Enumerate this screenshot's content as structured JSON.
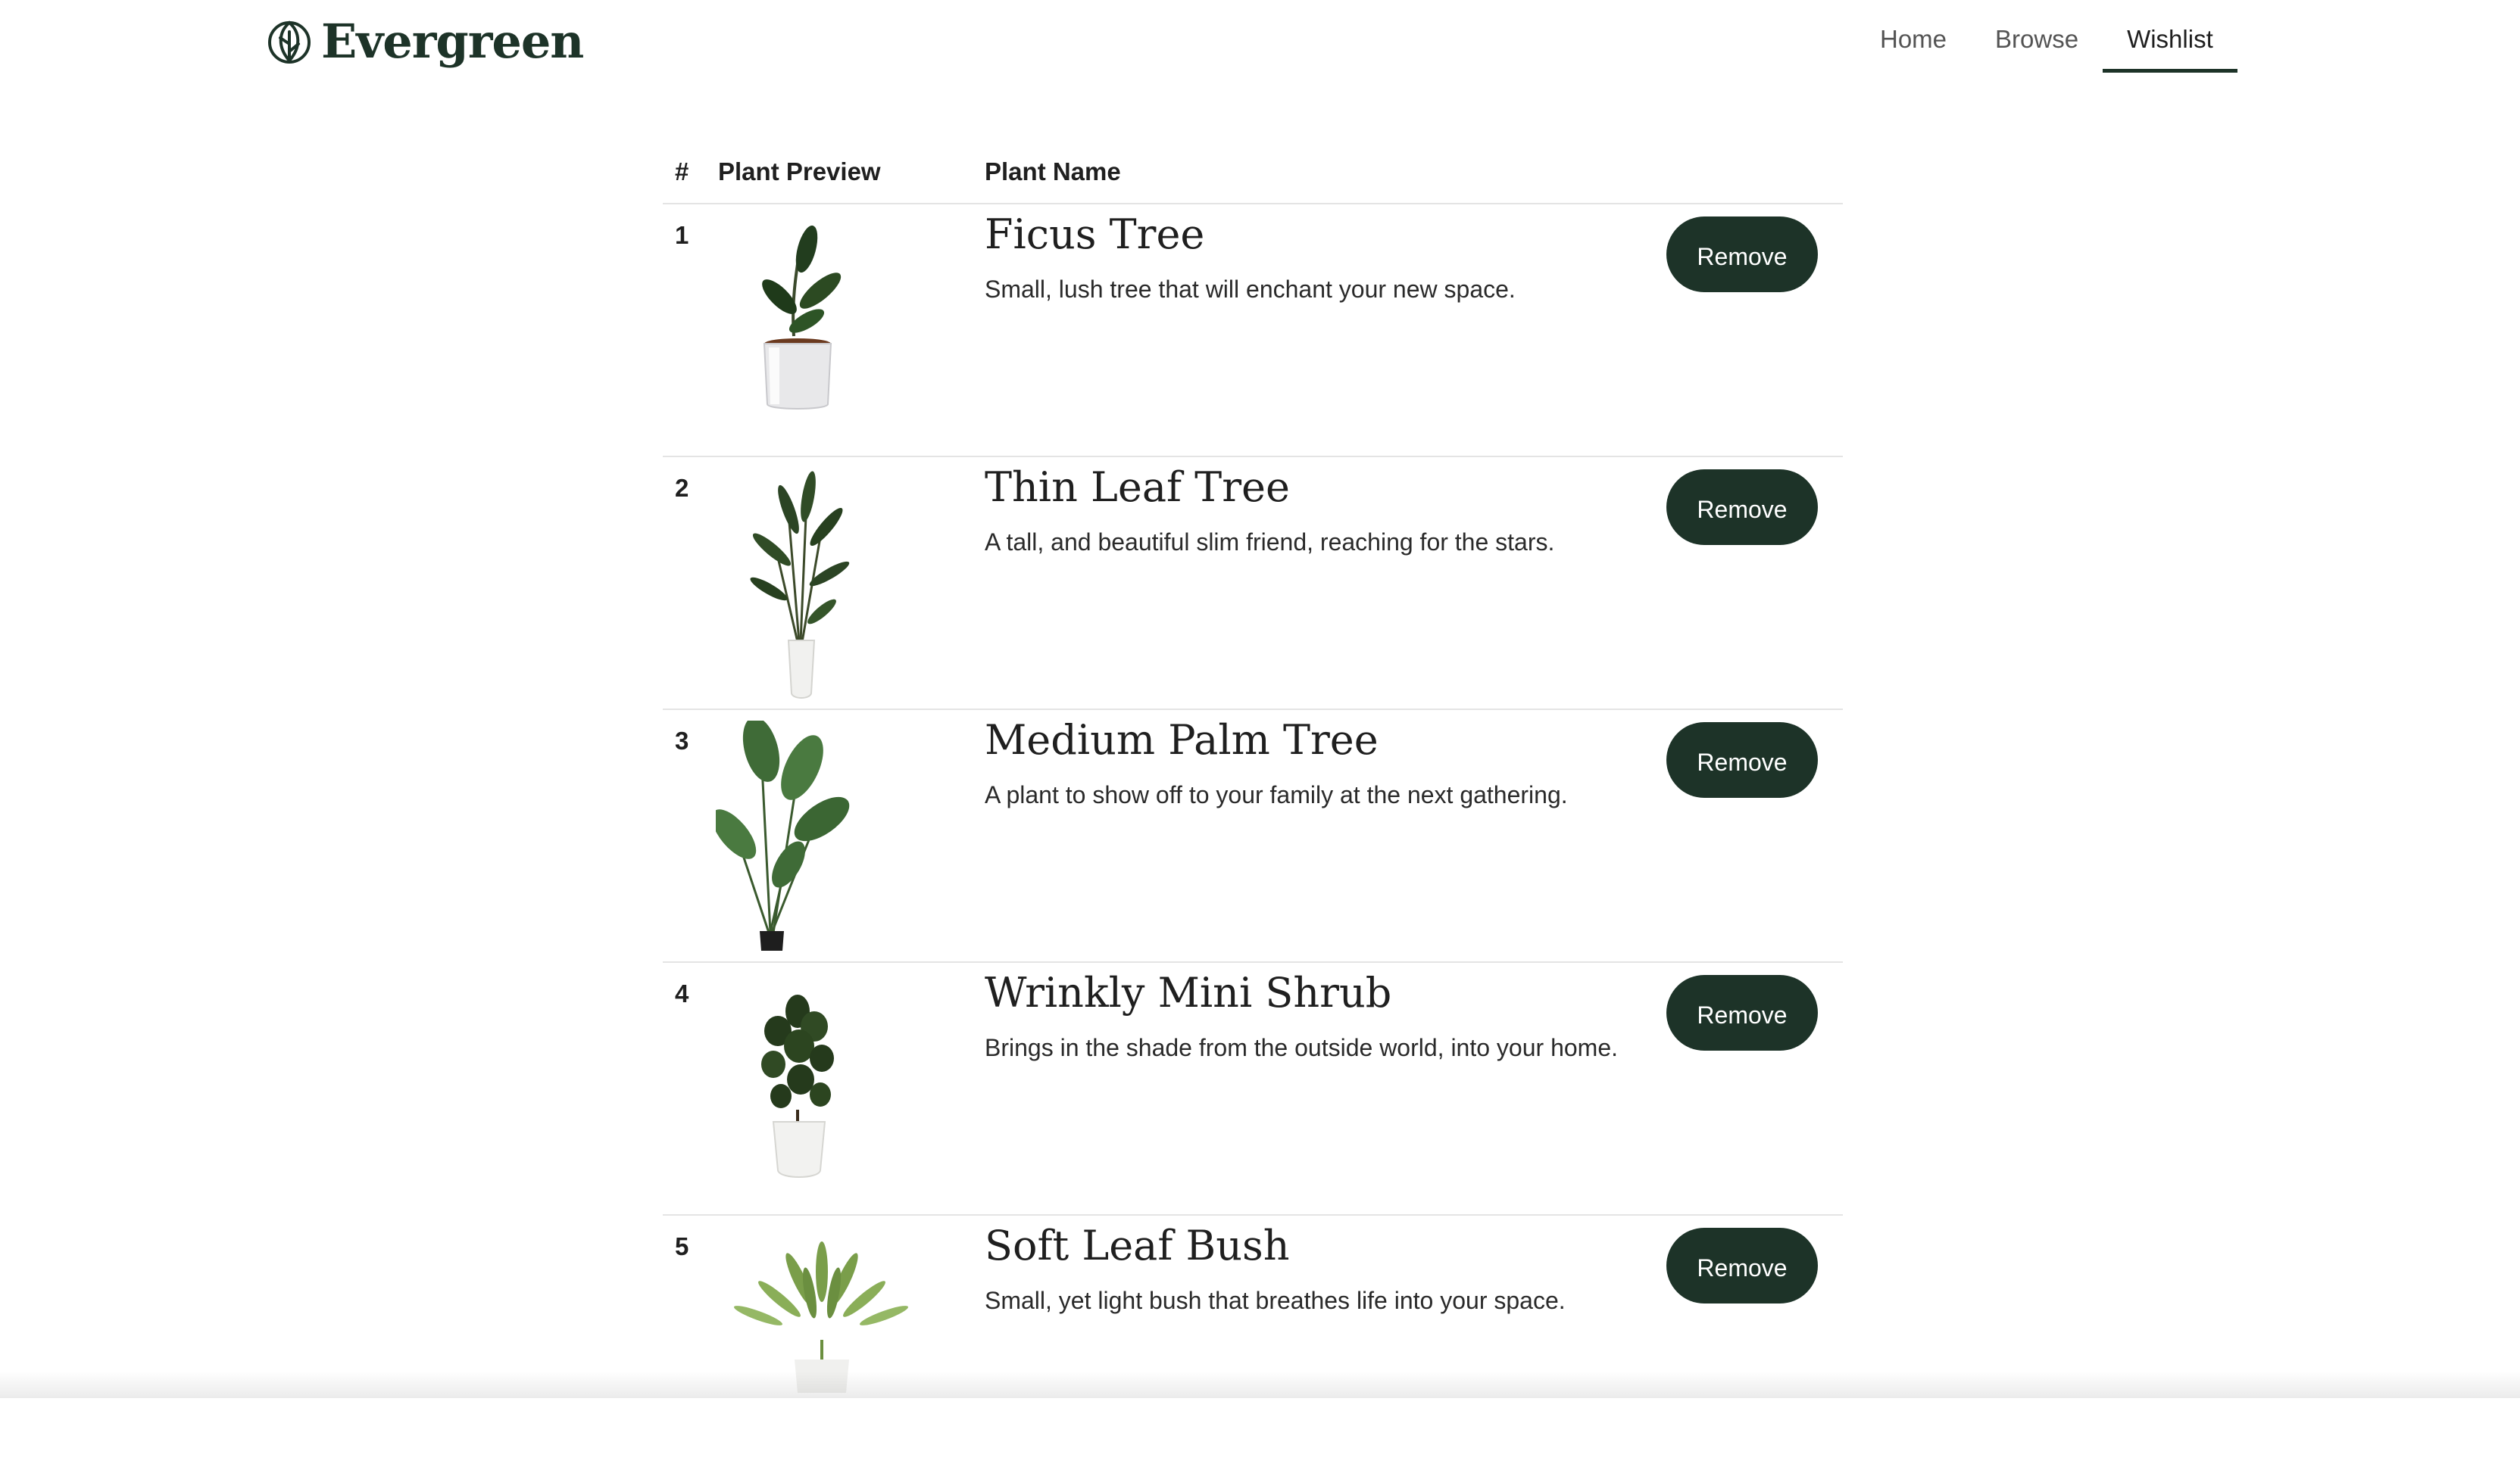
{
  "brand": {
    "name": "Evergreen",
    "logo_icon": "leaf-icon",
    "color": "#1d3328"
  },
  "nav": [
    {
      "label": "Home",
      "active": false
    },
    {
      "label": "Browse",
      "active": false
    },
    {
      "label": "Wishlist",
      "active": true
    }
  ],
  "table": {
    "headers": {
      "num": "#",
      "preview": "Plant Preview",
      "name": "Plant Name"
    },
    "rows": [
      {
        "num": "1",
        "name": "Ficus Tree",
        "description": "Small, lush tree that will enchant your new space.",
        "action": "Remove"
      },
      {
        "num": "2",
        "name": "Thin Leaf Tree",
        "description": "A tall, and beautiful slim friend, reaching for the stars.",
        "action": "Remove"
      },
      {
        "num": "3",
        "name": "Medium Palm Tree",
        "description": "A plant to show off to your family at the next gathering.",
        "action": "Remove"
      },
      {
        "num": "4",
        "name": "Wrinkly Mini Shrub",
        "description": "Brings in the shade from the outside world, into your home.",
        "action": "Remove"
      },
      {
        "num": "5",
        "name": "Soft Leaf Bush",
        "description": "Small, yet light bush that breathes life into your space.",
        "action": "Remove"
      }
    ]
  }
}
